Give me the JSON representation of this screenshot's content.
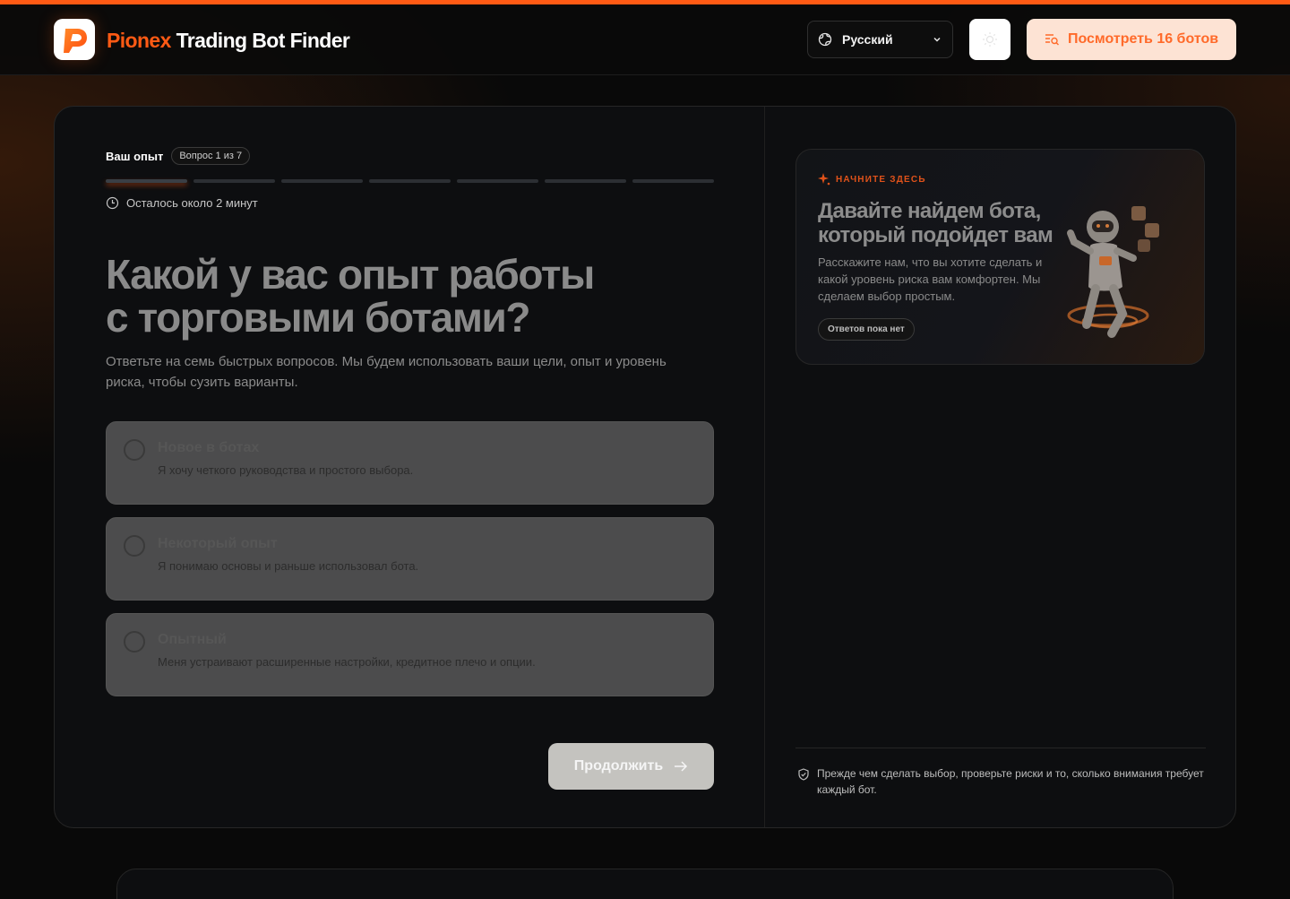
{
  "header": {
    "brand_accent": "Pionex",
    "brand_rest": "Trading Bot Finder",
    "language": "Русский",
    "cta_label": "Посмотреть 16 ботов"
  },
  "quiz": {
    "step_title": "Ваш опыт",
    "step_counter": "Вопрос 1 из 7",
    "progress": {
      "current": 1,
      "total": 7
    },
    "time_left": "Осталось около 2 минут",
    "question_line1": "Какой у вас опыт работы",
    "question_line2": "с торговыми ботами?",
    "subtext": "Ответьте на семь быстрых вопросов. Мы будем использовать ваши цели, опыт и уровень риска, чтобы сузить варианты.",
    "options": [
      {
        "title": "Новое в ботах",
        "desc": "Я хочу четкого руководства и простого выбора."
      },
      {
        "title": "Некоторый опыт",
        "desc": "Я понимаю основы и раньше использовал бота."
      },
      {
        "title": "Опытный",
        "desc": "Меня устраивают расширенные настройки, кредитное плечо и опции."
      }
    ],
    "continue_label": "Продолжить"
  },
  "promo": {
    "kicker": "НАЧНИТЕ ЗДЕСЬ",
    "title": "Давайте найдем бота, который подойдет вам",
    "description": "Расскажите нам, что вы хотите сделать и какой уровень риска вам комфортен. Мы сделаем выбор простым.",
    "badge": "Ответов пока нет"
  },
  "footer_note": "Прежде чем сделать выбор, проверьте риски и то, сколько внимания требует каждый бот.",
  "colors": {
    "accent": "#ff5a14",
    "cta_bg": "#fde3d4",
    "background": "#090909",
    "card": "#0d0e10"
  },
  "icons": [
    "pionex-logo-icon",
    "globe-icon",
    "chevron-down-icon",
    "sun-icon",
    "filter-search-icon",
    "clock-icon",
    "sparkle-icon",
    "arrow-right-icon",
    "shield-check-icon",
    "robot-mascot-illustration"
  ]
}
